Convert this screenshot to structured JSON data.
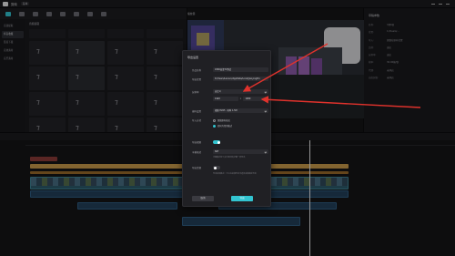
{
  "app": {
    "name": "剪映",
    "menu_label": "菜单"
  },
  "leftnav": {
    "items": [
      "音频提取",
      "抖音收藏",
      "链接下载",
      "音效素材",
      "音乐素材"
    ],
    "active_index": 1
  },
  "assets": {
    "header": "音频提取"
  },
  "preview": {
    "title": "播放器"
  },
  "inspector": {
    "title": "草稿参数",
    "rows": [
      {
        "k": "名称:",
        "v": "3月6日"
      },
      {
        "k": "位置:",
        "v": "C:/Users/..."
      },
      {
        "k": "导入:",
        "v": "保留在原有位置"
      },
      {
        "k": "比例:",
        "v": "适应"
      },
      {
        "k": "分辨率:",
        "v": "适应"
      },
      {
        "k": "帧率:",
        "v": "30.00帧/秒"
      },
      {
        "k": "代理:",
        "v": "未开启"
      },
      {
        "k": "自由层级:",
        "v": "未开启"
      }
    ]
  },
  "modal": {
    "title": "导出设置",
    "fields": [
      {
        "label": "作品名称",
        "value": "0306高清TV测试"
      },
      {
        "label": "导出位置",
        "value": "D:/Users/Lenovo/AppData/Local/JianyingPro"
      },
      {
        "label": "分辨率",
        "value": "自定义"
      }
    ],
    "resolution": {
      "label": "分辨率",
      "width": "1920",
      "height": "1080"
    },
    "encoding": {
      "label": "编码设置",
      "value": "视频 H265 · 码率 1.5M"
    },
    "import_label": "导入方式",
    "import_options": [
      "保留原有格式",
      "转码为常用格式"
    ],
    "import_selected": 1,
    "toggle_a": {
      "label": "导出视频",
      "on": true
    },
    "subtitle_format": {
      "label": "字幕格式",
      "value": "SRT"
    },
    "subtitle_hint": "字幕格式将与文字素材的字幕一同导出",
    "toggle_b": {
      "label": "导出音频",
      "on": false
    },
    "audio_hint": "导出音频格式：可以在音频导出中选择音频格式导出",
    "cancel_label": "取消",
    "ok_label": "导出"
  },
  "timeline": {
    "playhead_position_label": ""
  },
  "colors": {
    "accent": "#32c4d0",
    "annotation": "#e0322c"
  },
  "icons": [
    "note-icon",
    "chevron-down-icon",
    "toggle-icon"
  ]
}
